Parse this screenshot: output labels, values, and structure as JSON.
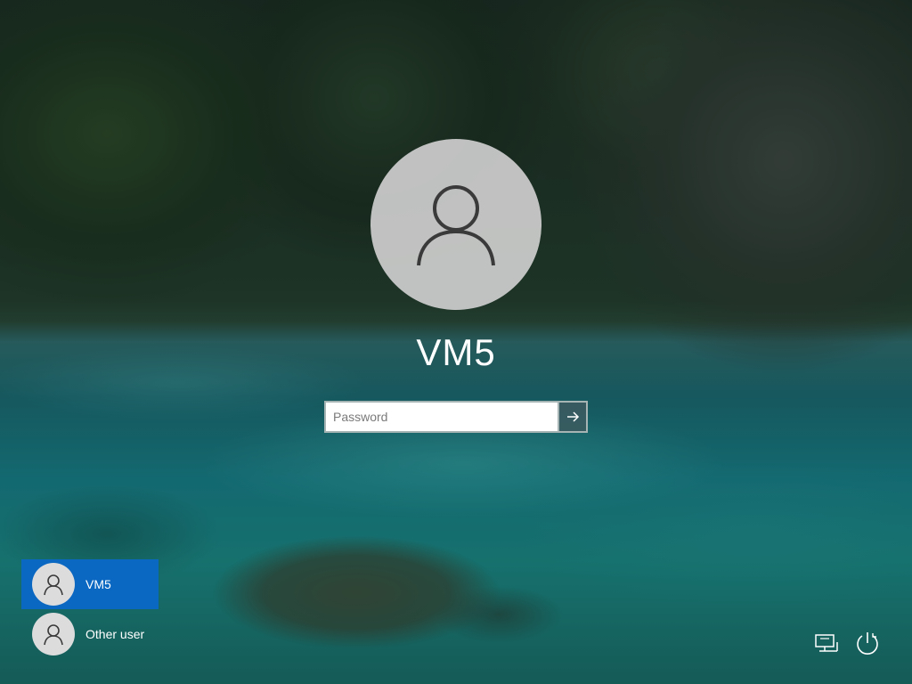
{
  "login": {
    "username": "VM5",
    "password_placeholder": "Password",
    "password_value": "",
    "submit_icon": "arrow-right-icon",
    "avatar_icon": "person-icon"
  },
  "user_list": {
    "users": [
      {
        "name": "VM5",
        "selected": true
      },
      {
        "name": "Other user",
        "selected": false
      }
    ]
  },
  "system_tray": {
    "network_icon": "network-icon",
    "power_icon": "power-icon"
  },
  "colors": {
    "selected_tile": "#0a67c2",
    "avatar_bg": "#cecece",
    "text": "#ffffff"
  }
}
